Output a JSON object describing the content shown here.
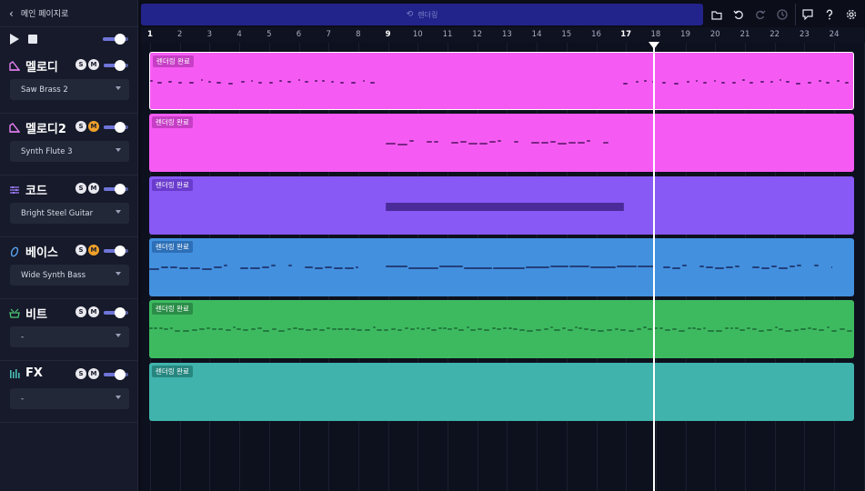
{
  "nav": {
    "back_label": "메인 페이지로"
  },
  "toolbar": {
    "render_label": "렌더링"
  },
  "colors": {
    "melody": "#f55bf2",
    "melody2": "#f55bf2",
    "chord": "#8859f5",
    "bass": "#4390df",
    "beat": "#3dba60",
    "fx": "#3fb3ac"
  },
  "ruler": {
    "bars": [
      "1",
      "2",
      "3",
      "4",
      "5",
      "6",
      "7",
      "8",
      "9",
      "10",
      "11",
      "12",
      "13",
      "14",
      "15",
      "16",
      "17",
      "18",
      "19",
      "20",
      "21",
      "22",
      "23",
      "24"
    ]
  },
  "tracks": [
    {
      "name": "멜로디",
      "instrument": "Saw Brass 2",
      "icon": "piano-icon",
      "s_label": "S",
      "m_label": "M",
      "muted": false,
      "clip_label": "렌더링 완료"
    },
    {
      "name": "멜로디2",
      "instrument": "Synth Flute 3",
      "icon": "piano-icon",
      "s_label": "S",
      "m_label": "M",
      "muted": true,
      "clip_label": "렌더링 완료"
    },
    {
      "name": "코드",
      "instrument": "Bright Steel Guitar",
      "icon": "sliders-icon",
      "s_label": "S",
      "m_label": "M",
      "muted": false,
      "clip_label": "렌더링 완료"
    },
    {
      "name": "베이스",
      "instrument": "Wide Synth Bass",
      "icon": "guitar-icon",
      "s_label": "S",
      "m_label": "M",
      "muted": true,
      "clip_label": "렌더링 완료"
    },
    {
      "name": "비트",
      "instrument": "-",
      "icon": "drum-icon",
      "s_label": "S",
      "m_label": "M",
      "muted": false,
      "clip_label": "렌더링 완료"
    },
    {
      "name": "FX",
      "instrument": "-",
      "icon": "equalizer-icon",
      "s_label": "S",
      "m_label": "M",
      "muted": false,
      "clip_label": "렌더링 완료"
    }
  ]
}
